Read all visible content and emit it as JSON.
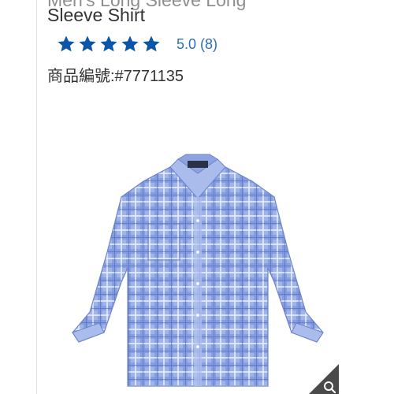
{
  "product": {
    "title_prev_line": "Men's Long Sleeve Long",
    "title_line": "Sleeve Shirt",
    "rating_value": "5.0",
    "rating_count": "(8)",
    "stars_filled": 5,
    "sku_text": "商品編號:#7771135",
    "image_icon": "checked-dress-shirt",
    "zoom_icon": "magnifier-icon"
  },
  "colors": {
    "star": "#0b56a8",
    "rating_text": "#2a6fb7",
    "shirt_base": "#8fa7e3",
    "shirt_check": "#5b78c9"
  }
}
